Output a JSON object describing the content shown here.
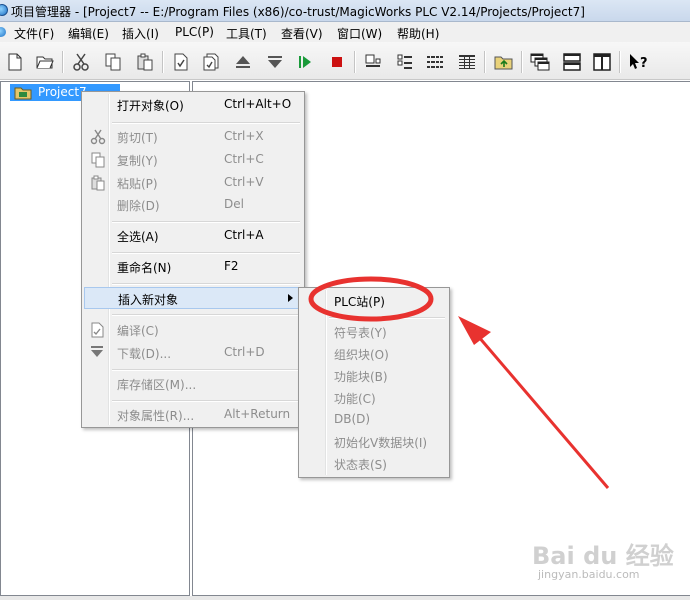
{
  "window": {
    "title": "项目管理器 - [Project7 -- E:/Program Files (x86)/co-trust/MagicWorks PLC V2.14/Projects/Project7]"
  },
  "menubar": {
    "items": [
      "文件(F)",
      "编辑(E)",
      "插入(I)",
      "PLC(P)",
      "工具(T)",
      "查看(V)",
      "窗口(W)",
      "帮助(H)"
    ]
  },
  "toolbar": {
    "buttons": [
      "new-icon",
      "open-icon",
      "cut-icon",
      "copy-icon",
      "paste-icon",
      "compile-icon",
      "compile-all-icon",
      "upload-icon",
      "download-icon",
      "run-icon",
      "stop-icon",
      "large-icons-icon",
      "small-icons-icon",
      "list-icon",
      "details-icon",
      "folder-up-icon",
      "cascade-icon",
      "tile-horizontal-icon",
      "tile-vertical-icon",
      "help-icon"
    ]
  },
  "tree": {
    "project_label": "Project7"
  },
  "context_menu": {
    "items": [
      {
        "label": "打开对象(O)",
        "shortcut": "Ctrl+Alt+O",
        "enabled": true
      },
      {
        "label": "剪切(T)",
        "shortcut": "Ctrl+X",
        "enabled": false,
        "icon": "scissors-icon"
      },
      {
        "label": "复制(Y)",
        "shortcut": "Ctrl+C",
        "enabled": false,
        "icon": "copy-icon"
      },
      {
        "label": "粘贴(P)",
        "shortcut": "Ctrl+V",
        "enabled": false,
        "icon": "paste-icon"
      },
      {
        "label": "删除(D)",
        "shortcut": "Del",
        "enabled": false
      },
      {
        "label": "全选(A)",
        "shortcut": "Ctrl+A",
        "enabled": true
      },
      {
        "label": "重命名(N)",
        "shortcut": "F2",
        "enabled": true
      },
      {
        "label": "插入新对象",
        "shortcut": "",
        "enabled": true,
        "submenu": true
      },
      {
        "label": "编译(C)",
        "shortcut": "",
        "enabled": false,
        "icon": "compile-icon"
      },
      {
        "label": "下载(D)...",
        "shortcut": "Ctrl+D",
        "enabled": false,
        "icon": "download-icon"
      },
      {
        "label": "库存储区(M)...",
        "shortcut": "",
        "enabled": false
      },
      {
        "label": "对象属性(R)...",
        "shortcut": "Alt+Return",
        "enabled": false
      }
    ]
  },
  "submenu": {
    "items": [
      {
        "label": "PLC站(P)",
        "enabled": true
      },
      {
        "label": "符号表(Y)",
        "enabled": false
      },
      {
        "label": "组织块(O)",
        "enabled": false
      },
      {
        "label": "功能块(B)",
        "enabled": false
      },
      {
        "label": "功能(C)",
        "enabled": false
      },
      {
        "label": "DB(D)",
        "enabled": false
      },
      {
        "label": "初始化V数据块(I)",
        "enabled": false
      },
      {
        "label": "状态表(S)",
        "enabled": false
      }
    ]
  },
  "annotation": {
    "color": "#e8322f"
  },
  "watermark": {
    "main": "Bai du 经验",
    "sub": "jingyan.baidu.com"
  }
}
